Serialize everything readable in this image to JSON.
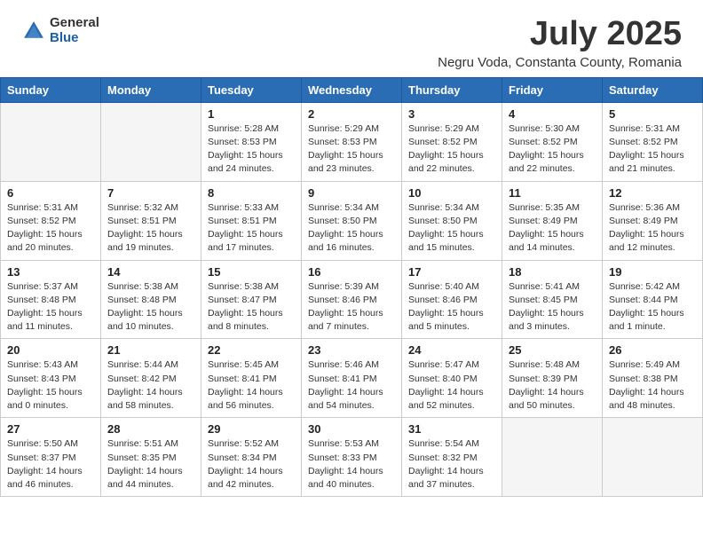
{
  "header": {
    "logo_general": "General",
    "logo_blue": "Blue",
    "month_year": "July 2025",
    "location": "Negru Voda, Constanta County, Romania"
  },
  "weekdays": [
    "Sunday",
    "Monday",
    "Tuesday",
    "Wednesday",
    "Thursday",
    "Friday",
    "Saturday"
  ],
  "weeks": [
    [
      {
        "day": "",
        "info": ""
      },
      {
        "day": "",
        "info": ""
      },
      {
        "day": "1",
        "info": "Sunrise: 5:28 AM\nSunset: 8:53 PM\nDaylight: 15 hours and 24 minutes."
      },
      {
        "day": "2",
        "info": "Sunrise: 5:29 AM\nSunset: 8:53 PM\nDaylight: 15 hours and 23 minutes."
      },
      {
        "day": "3",
        "info": "Sunrise: 5:29 AM\nSunset: 8:52 PM\nDaylight: 15 hours and 22 minutes."
      },
      {
        "day": "4",
        "info": "Sunrise: 5:30 AM\nSunset: 8:52 PM\nDaylight: 15 hours and 22 minutes."
      },
      {
        "day": "5",
        "info": "Sunrise: 5:31 AM\nSunset: 8:52 PM\nDaylight: 15 hours and 21 minutes."
      }
    ],
    [
      {
        "day": "6",
        "info": "Sunrise: 5:31 AM\nSunset: 8:52 PM\nDaylight: 15 hours and 20 minutes."
      },
      {
        "day": "7",
        "info": "Sunrise: 5:32 AM\nSunset: 8:51 PM\nDaylight: 15 hours and 19 minutes."
      },
      {
        "day": "8",
        "info": "Sunrise: 5:33 AM\nSunset: 8:51 PM\nDaylight: 15 hours and 17 minutes."
      },
      {
        "day": "9",
        "info": "Sunrise: 5:34 AM\nSunset: 8:50 PM\nDaylight: 15 hours and 16 minutes."
      },
      {
        "day": "10",
        "info": "Sunrise: 5:34 AM\nSunset: 8:50 PM\nDaylight: 15 hours and 15 minutes."
      },
      {
        "day": "11",
        "info": "Sunrise: 5:35 AM\nSunset: 8:49 PM\nDaylight: 15 hours and 14 minutes."
      },
      {
        "day": "12",
        "info": "Sunrise: 5:36 AM\nSunset: 8:49 PM\nDaylight: 15 hours and 12 minutes."
      }
    ],
    [
      {
        "day": "13",
        "info": "Sunrise: 5:37 AM\nSunset: 8:48 PM\nDaylight: 15 hours and 11 minutes."
      },
      {
        "day": "14",
        "info": "Sunrise: 5:38 AM\nSunset: 8:48 PM\nDaylight: 15 hours and 10 minutes."
      },
      {
        "day": "15",
        "info": "Sunrise: 5:38 AM\nSunset: 8:47 PM\nDaylight: 15 hours and 8 minutes."
      },
      {
        "day": "16",
        "info": "Sunrise: 5:39 AM\nSunset: 8:46 PM\nDaylight: 15 hours and 7 minutes."
      },
      {
        "day": "17",
        "info": "Sunrise: 5:40 AM\nSunset: 8:46 PM\nDaylight: 15 hours and 5 minutes."
      },
      {
        "day": "18",
        "info": "Sunrise: 5:41 AM\nSunset: 8:45 PM\nDaylight: 15 hours and 3 minutes."
      },
      {
        "day": "19",
        "info": "Sunrise: 5:42 AM\nSunset: 8:44 PM\nDaylight: 15 hours and 1 minute."
      }
    ],
    [
      {
        "day": "20",
        "info": "Sunrise: 5:43 AM\nSunset: 8:43 PM\nDaylight: 15 hours and 0 minutes."
      },
      {
        "day": "21",
        "info": "Sunrise: 5:44 AM\nSunset: 8:42 PM\nDaylight: 14 hours and 58 minutes."
      },
      {
        "day": "22",
        "info": "Sunrise: 5:45 AM\nSunset: 8:41 PM\nDaylight: 14 hours and 56 minutes."
      },
      {
        "day": "23",
        "info": "Sunrise: 5:46 AM\nSunset: 8:41 PM\nDaylight: 14 hours and 54 minutes."
      },
      {
        "day": "24",
        "info": "Sunrise: 5:47 AM\nSunset: 8:40 PM\nDaylight: 14 hours and 52 minutes."
      },
      {
        "day": "25",
        "info": "Sunrise: 5:48 AM\nSunset: 8:39 PM\nDaylight: 14 hours and 50 minutes."
      },
      {
        "day": "26",
        "info": "Sunrise: 5:49 AM\nSunset: 8:38 PM\nDaylight: 14 hours and 48 minutes."
      }
    ],
    [
      {
        "day": "27",
        "info": "Sunrise: 5:50 AM\nSunset: 8:37 PM\nDaylight: 14 hours and 46 minutes."
      },
      {
        "day": "28",
        "info": "Sunrise: 5:51 AM\nSunset: 8:35 PM\nDaylight: 14 hours and 44 minutes."
      },
      {
        "day": "29",
        "info": "Sunrise: 5:52 AM\nSunset: 8:34 PM\nDaylight: 14 hours and 42 minutes."
      },
      {
        "day": "30",
        "info": "Sunrise: 5:53 AM\nSunset: 8:33 PM\nDaylight: 14 hours and 40 minutes."
      },
      {
        "day": "31",
        "info": "Sunrise: 5:54 AM\nSunset: 8:32 PM\nDaylight: 14 hours and 37 minutes."
      },
      {
        "day": "",
        "info": ""
      },
      {
        "day": "",
        "info": ""
      }
    ]
  ]
}
